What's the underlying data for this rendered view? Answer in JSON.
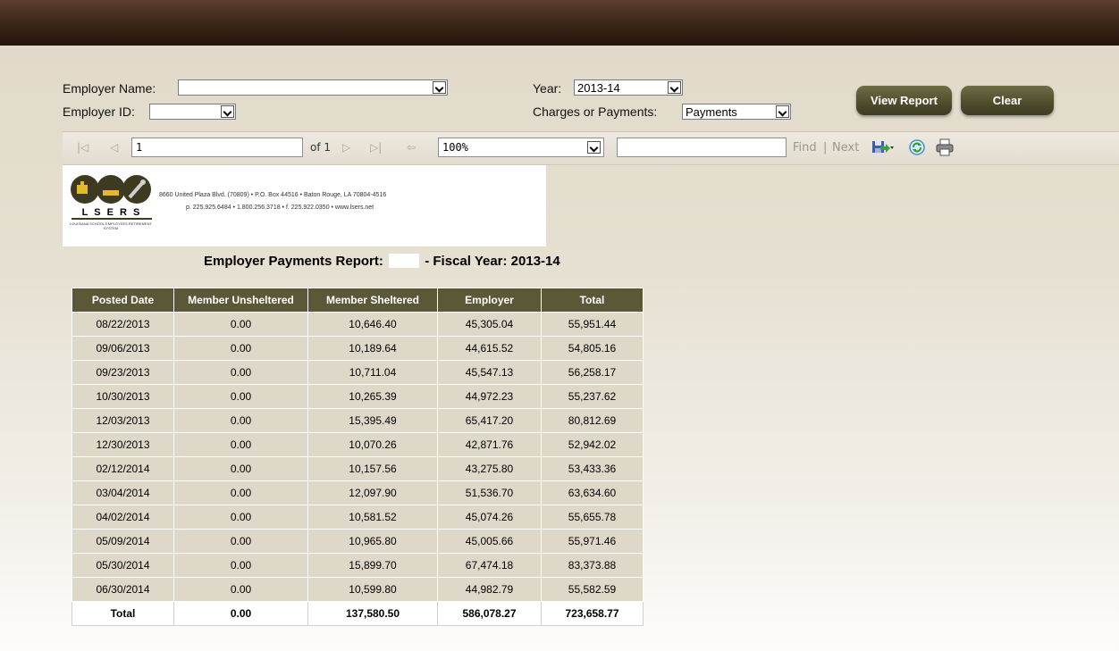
{
  "filters": {
    "employer_name_label": "Employer Name:",
    "employer_name_value": "",
    "employer_id_label": "Employer ID:",
    "employer_id_value": "",
    "year_label": "Year:",
    "year_value": "2013-14",
    "charges_label": "Charges or Payments:",
    "charges_value": "Payments"
  },
  "buttons": {
    "view_report": "View Report",
    "clear": "Clear"
  },
  "toolbar": {
    "page_value": "1",
    "page_of": "of 1",
    "zoom_value": "100%",
    "find_value": "",
    "find": "Find",
    "separator": "|",
    "next": "Next"
  },
  "logo": {
    "letters": "L S E R S",
    "org_name": "LOUISIANA SCHOOL EMPLOYEES RETIREMENT SYSTEM",
    "address": "8660 United Plaza Blvd. (70809) • P.O. Box 44516 • Baton Rouge, LA 70804-4516",
    "contact": "p. 225.925.6484 • 1.800.256.3718 • f. 225.922.0350 • www.lsers.net"
  },
  "report": {
    "title_prefix": "Employer Payments Report:",
    "title_suffix": "- Fiscal Year: 2013-14",
    "columns": [
      "Posted Date",
      "Member Unsheltered",
      "Member Sheltered",
      "Employer",
      "Total"
    ],
    "rows": [
      [
        "08/22/2013",
        "0.00",
        "10,646.40",
        "45,305.04",
        "55,951.44"
      ],
      [
        "09/06/2013",
        "0.00",
        "10,189.64",
        "44,615.52",
        "54,805.16"
      ],
      [
        "09/23/2013",
        "0.00",
        "10,711.04",
        "45,547.13",
        "56,258.17"
      ],
      [
        "10/30/2013",
        "0.00",
        "10,265.39",
        "44,972.23",
        "55,237.62"
      ],
      [
        "12/03/2013",
        "0.00",
        "15,395.49",
        "65,417.20",
        "80,812.69"
      ],
      [
        "12/30/2013",
        "0.00",
        "10,070.26",
        "42,871.76",
        "52,942.02"
      ],
      [
        "02/12/2014",
        "0.00",
        "10,157.56",
        "43,275.80",
        "53,433.36"
      ],
      [
        "03/04/2014",
        "0.00",
        "12,097.90",
        "51,536.70",
        "63,634.60"
      ],
      [
        "04/02/2014",
        "0.00",
        "10,581.52",
        "45,074.26",
        "55,655.78"
      ],
      [
        "05/09/2014",
        "0.00",
        "10,965.80",
        "45,005.66",
        "55,971.46"
      ],
      [
        "05/30/2014",
        "0.00",
        "15,899.70",
        "67,474.18",
        "83,373.88"
      ],
      [
        "06/30/2014",
        "0.00",
        "10,599.80",
        "44,982.79",
        "55,582.59"
      ]
    ],
    "total": [
      "Total",
      "0.00",
      "137,580.50",
      "586,078.27",
      "723,658.77"
    ]
  },
  "icons": [
    "first-page-icon",
    "prev-page-icon",
    "next-page-icon",
    "last-page-icon",
    "back-icon",
    "export-icon",
    "refresh-icon",
    "print-icon"
  ],
  "colors": {
    "header_bar": "#3b2417",
    "button": "#4e4c2c",
    "table_header": "#5a5837",
    "table_cell": "#ddd8c8"
  }
}
